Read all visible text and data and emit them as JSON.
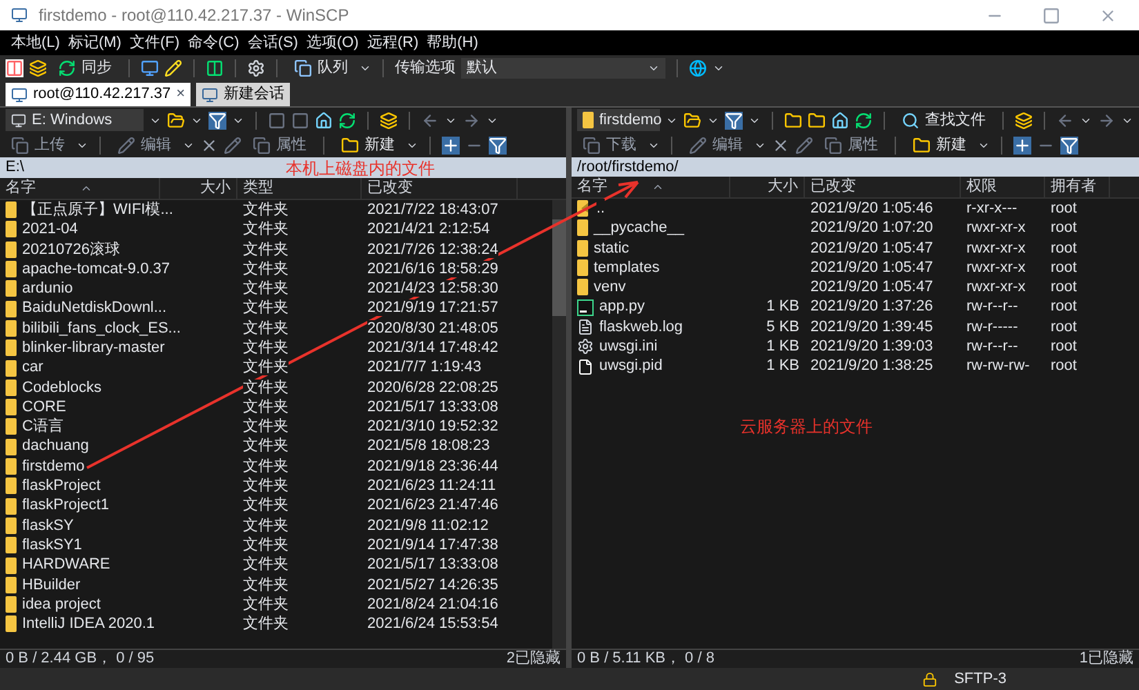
{
  "window": {
    "title": "firstdemo - root@110.42.217.37 - WinSCP"
  },
  "menu": [
    "本地(L)",
    "标记(M)",
    "文件(F)",
    "命令(C)",
    "会话(S)",
    "选项(O)",
    "远程(R)",
    "帮助(H)"
  ],
  "toolbar": {
    "sync": "同步",
    "queue": "队列",
    "transfer_label": "传输选项",
    "transfer_value": "默认"
  },
  "tabs": [
    {
      "label": "root@110.42.217.37",
      "selected": true,
      "close": "×"
    },
    {
      "label": "新建会话",
      "selected": false
    }
  ],
  "left_pane": {
    "location": "E: Windows",
    "transfer": "上传",
    "edit": "编辑",
    "properties": "属性",
    "new": "新建",
    "path": "E:\\",
    "columns": [
      "名字",
      "大小",
      "类型",
      "已改变"
    ],
    "rows": [
      {
        "name": "【正点原子】WIFI模...",
        "type": "文件夹",
        "changed": "2021/7/22  18:43:07"
      },
      {
        "name": "2021-04",
        "type": "文件夹",
        "changed": "2021/4/21  2:12:54"
      },
      {
        "name": "20210726滚球",
        "type": "文件夹",
        "changed": "2021/7/26  12:38:24"
      },
      {
        "name": "apache-tomcat-9.0.37",
        "type": "文件夹",
        "changed": "2021/6/16  18:58:29"
      },
      {
        "name": "ardunio",
        "type": "文件夹",
        "changed": "2021/4/23  12:58:30"
      },
      {
        "name": "BaiduNetdiskDownl...",
        "type": "文件夹",
        "changed": "2021/9/19  17:21:57"
      },
      {
        "name": "bilibili_fans_clock_ES...",
        "type": "文件夹",
        "changed": "2020/8/30  21:48:05"
      },
      {
        "name": "blinker-library-master",
        "type": "文件夹",
        "changed": "2021/3/14  17:48:42"
      },
      {
        "name": "car",
        "type": "文件夹",
        "changed": "2021/7/7  1:19:43"
      },
      {
        "name": "Codeblocks",
        "type": "文件夹",
        "changed": "2020/6/28  22:08:25"
      },
      {
        "name": "CORE",
        "type": "文件夹",
        "changed": "2021/5/17  13:33:08"
      },
      {
        "name": "C语言",
        "type": "文件夹",
        "changed": "2021/3/10  19:52:32"
      },
      {
        "name": "dachuang",
        "type": "文件夹",
        "changed": "2021/5/8  18:08:23"
      },
      {
        "name": "firstdemo",
        "type": "文件夹",
        "changed": "2021/9/18  23:36:44"
      },
      {
        "name": "flaskProject",
        "type": "文件夹",
        "changed": "2021/6/23  11:24:11"
      },
      {
        "name": "flaskProject1",
        "type": "文件夹",
        "changed": "2021/6/23  21:47:46"
      },
      {
        "name": "flaskSY",
        "type": "文件夹",
        "changed": "2021/9/8  11:02:12"
      },
      {
        "name": "flaskSY1",
        "type": "文件夹",
        "changed": "2021/9/14  17:47:38"
      },
      {
        "name": "HARDWARE",
        "type": "文件夹",
        "changed": "2021/5/17  13:33:08"
      },
      {
        "name": "HBuilder",
        "type": "文件夹",
        "changed": "2021/5/27  14:26:35"
      },
      {
        "name": "idea project",
        "type": "文件夹",
        "changed": "2021/8/24  21:04:16"
      },
      {
        "name": "IntelliJ IDEA 2020.1",
        "type": "文件夹",
        "changed": "2021/6/24  15:53:54"
      }
    ],
    "status": "0 B / 2.44 GB， 0 / 95",
    "hidden": "2已隐藏"
  },
  "right_pane": {
    "location": "firstdemo",
    "find": "查找文件",
    "transfer": "下载",
    "edit": "编辑",
    "properties": "属性",
    "new": "新建",
    "path": "/root/firstdemo/",
    "columns": [
      "名字",
      "大小",
      "已改变",
      "权限",
      "拥有者"
    ],
    "rows": [
      {
        "kind": "parent",
        "name": "..",
        "changed": "2021/9/20 1:05:46",
        "rights": "r-xr-x---",
        "owner": "root"
      },
      {
        "kind": "folder",
        "name": "__pycache__",
        "changed": "2021/9/20 1:07:20",
        "rights": "rwxr-xr-x",
        "owner": "root"
      },
      {
        "kind": "folder",
        "name": "static",
        "changed": "2021/9/20 1:05:47",
        "rights": "rwxr-xr-x",
        "owner": "root"
      },
      {
        "kind": "folder",
        "name": "templates",
        "changed": "2021/9/20 1:05:47",
        "rights": "rwxr-xr-x",
        "owner": "root"
      },
      {
        "kind": "folder",
        "name": "venv",
        "changed": "2021/9/20 1:05:47",
        "rights": "rwxr-xr-x",
        "owner": "root"
      },
      {
        "kind": "python",
        "name": "app.py",
        "size": "1 KB",
        "changed": "2021/9/20 1:37:26",
        "rights": "rw-r--r--",
        "owner": "root"
      },
      {
        "kind": "log",
        "name": "flaskweb.log",
        "size": "5 KB",
        "changed": "2021/9/20 1:39:45",
        "rights": "rw-r-----",
        "owner": "root"
      },
      {
        "kind": "settings",
        "name": "uwsgi.ini",
        "size": "1 KB",
        "changed": "2021/9/20 1:39:03",
        "rights": "rw-r--r--",
        "owner": "root"
      },
      {
        "kind": "file",
        "name": "uwsgi.pid",
        "size": "1 KB",
        "changed": "2021/9/20 1:38:25",
        "rights": "rw-rw-rw-",
        "owner": "root"
      }
    ],
    "status": "0 B / 5.11 KB， 0 / 8",
    "hidden": "1已隐藏"
  },
  "status_bar": {
    "protocol": "SFTP-3"
  },
  "annotations": [
    {
      "text": "本机上磁盘内的文件"
    },
    {
      "text": "云服务器上的文件"
    }
  ]
}
